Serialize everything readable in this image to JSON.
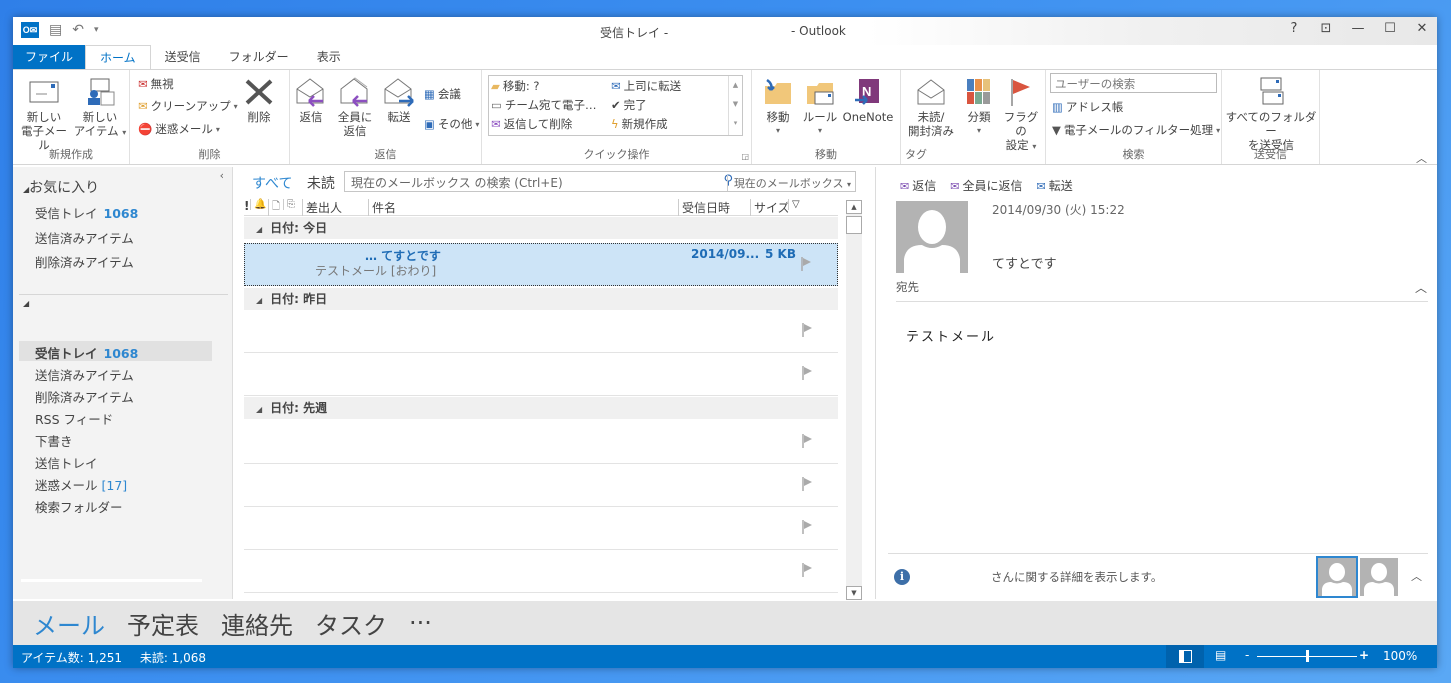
{
  "window": {
    "title_left": "受信トレイ -",
    "title_right": "- Outlook",
    "controls": [
      "?",
      "⊡",
      "—",
      "☐",
      "✕"
    ]
  },
  "tabs": [
    {
      "label": "ファイル"
    },
    {
      "label": "ホーム",
      "active": true
    },
    {
      "label": "送受信"
    },
    {
      "label": "フォルダー"
    },
    {
      "label": "表示"
    }
  ],
  "ribbon": {
    "new": {
      "label": "新規作成",
      "new_mail": [
        "新しい",
        "電子メール"
      ],
      "new_item": [
        "新しい",
        "アイテム"
      ]
    },
    "delete": {
      "label": "削除",
      "ignore": "無視",
      "cleanup": "クリーンアップ",
      "junk": "迷惑メール",
      "delete": "削除"
    },
    "respond": {
      "label": "返信",
      "reply": "返信",
      "reply_all": [
        "全員に",
        "返信"
      ],
      "forward": "転送",
      "meeting": "会議",
      "more": "その他"
    },
    "quick_steps": {
      "label": "クイック操作",
      "items": [
        "移動: ?",
        "上司に転送",
        "チーム宛て電子…",
        "完了",
        "返信して削除",
        "新規作成"
      ]
    },
    "move": {
      "label": "移動",
      "move": "移動",
      "rules": "ルール",
      "onenote": "OneNote"
    },
    "tags": {
      "label": "タグ",
      "unread_read": [
        "未読/",
        "開封済み"
      ],
      "categorize": "分類",
      "followup": [
        "フラグの",
        "設定"
      ]
    },
    "find": {
      "label": "検索",
      "search_people_placeholder": "ユーザーの検索",
      "address_book": "アドレス帳",
      "filter_email": "電子メールのフィルター処理"
    },
    "send_receive": {
      "label": "送受信",
      "all_folders": [
        "すべてのフォルダー",
        "を送受信"
      ]
    }
  },
  "nav": {
    "favorites_header": "お気に入り",
    "favorites": [
      {
        "label": "受信トレイ",
        "count": "1068"
      },
      {
        "label": "送信済みアイテム"
      },
      {
        "label": "削除済みアイテム"
      }
    ],
    "folders": [
      {
        "label": "受信トレイ",
        "count": "1068",
        "selected": true
      },
      {
        "label": "送信済みアイテム"
      },
      {
        "label": "削除済みアイテム"
      },
      {
        "label": "RSS フィード"
      },
      {
        "label": "下書き"
      },
      {
        "label": "送信トレイ"
      },
      {
        "label": "迷惑メール",
        "count": "[17]"
      },
      {
        "label": "検索フォルダー"
      }
    ]
  },
  "list": {
    "filter_all": "すべて",
    "filter_unread": "未読",
    "search_placeholder": "現在のメールボックス の検索 (Ctrl+E)",
    "search_scope": "現在のメールボックス",
    "columns": [
      "!",
      "🔔",
      "🗋",
      "📎",
      "差出人",
      "件名",
      "受信日時",
      "サイズ",
      "▽"
    ],
    "groups": [
      {
        "label": "日付: 今日"
      },
      {
        "label": "日付: 昨日"
      },
      {
        "label": "日付: 先週"
      }
    ],
    "selected_message": {
      "subject": "…  てすとです",
      "preview": "テストメール [おわり]",
      "date": "2014/09...",
      "size": "5 KB"
    }
  },
  "reading": {
    "actions": [
      "返信",
      "全員に返信",
      "転送"
    ],
    "date": "2014/09/30 (火) 15:22",
    "subject": "てすとです",
    "to_label": "宛先",
    "body": "テストメール",
    "people_text": "さんに関する詳細を表示します。"
  },
  "bottom_nav": [
    "メール",
    "予定表",
    "連絡先",
    "タスク",
    "···"
  ],
  "status": {
    "items": "アイテム数: 1,251",
    "unread": "未読: 1,068",
    "zoom": "100%",
    "zoom_value": 50
  }
}
